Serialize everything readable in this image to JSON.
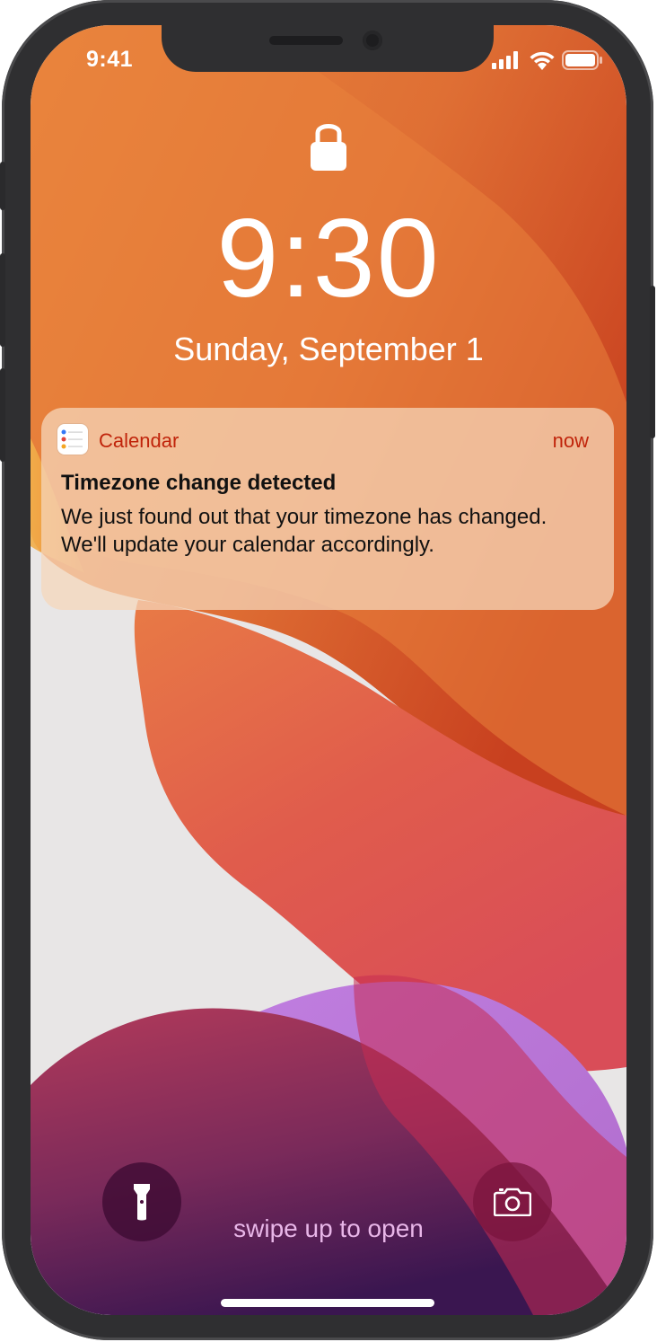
{
  "status_bar": {
    "time": "9:41",
    "icons": [
      "cellular-signal-icon",
      "wifi-icon",
      "battery-icon"
    ]
  },
  "lock_screen": {
    "lock_icon": "padlock-icon",
    "time": "9:30",
    "date": "Sunday, September 1"
  },
  "notification": {
    "app_icon": "calendar-app-icon",
    "app_name": "Calendar",
    "time": "now",
    "title": "Timezone change detected",
    "body": "We just found out that your timezone has changed. We'll update your calendar accordingly."
  },
  "quick_actions": {
    "left_icon": "flashlight-icon",
    "right_icon": "camera-icon"
  },
  "swipe_hint": "swipe up to open",
  "colors": {
    "accent": "#c0240b",
    "wallpaper_orange": "#e0743a",
    "wallpaper_red": "#dd4f55",
    "wallpaper_purple": "#b676d6"
  }
}
